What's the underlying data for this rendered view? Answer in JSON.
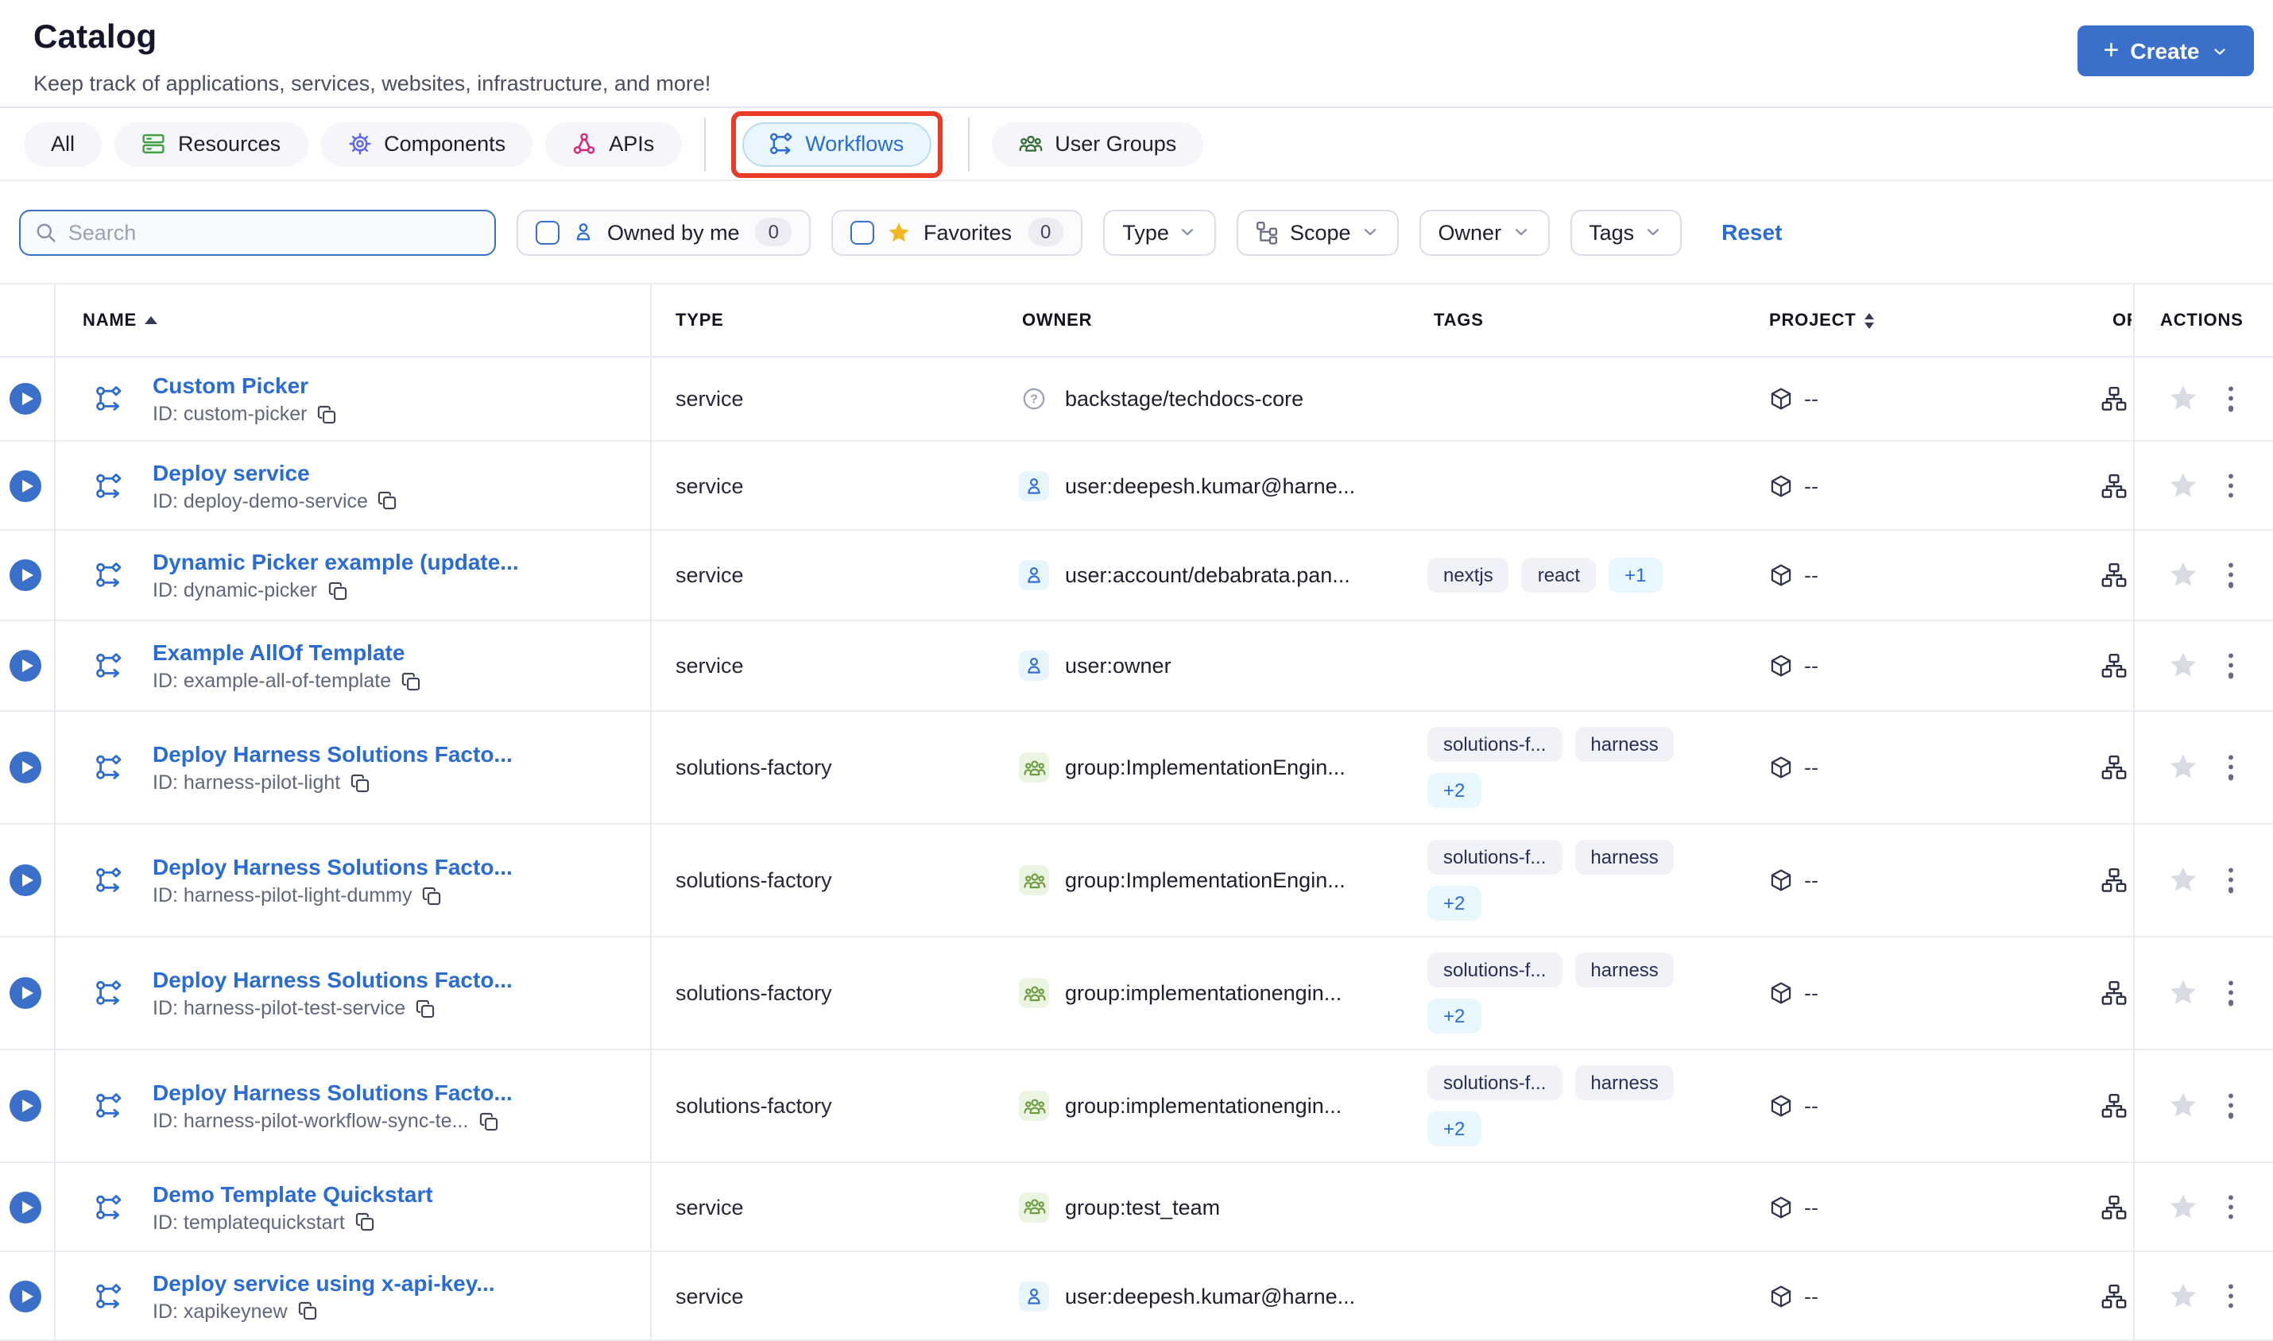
{
  "colors": {
    "primary": "#3A70C9",
    "link": "#2B6CD4",
    "annotation": "#EA3A28",
    "green": "#3FA13F",
    "indigo": "#5D66E3",
    "pink": "#D92475",
    "dgreen": "#2F6B2F",
    "ogreen": "#6A9B3F",
    "tagtext": "#263056",
    "star": "#D8DAE4",
    "favstar": "#F1B822"
  },
  "header": {
    "title": "Catalog",
    "subtitle": "Keep track of applications, services, websites, infrastructure, and more!",
    "create_label": "Create"
  },
  "tabs": {
    "all": "All",
    "resources": "Resources",
    "components": "Components",
    "apis": "APIs",
    "workflows": "Workflows",
    "user_groups": "User Groups"
  },
  "filters": {
    "search_placeholder": "Search",
    "owned_by_me": "Owned by me",
    "owned_count": "0",
    "favorites": "Favorites",
    "favorites_count": "0",
    "type": "Type",
    "scope": "Scope",
    "owner": "Owner",
    "tags": "Tags",
    "reset": "Reset"
  },
  "table": {
    "columns": {
      "name": "NAME",
      "type": "TYPE",
      "owner": "OWNER",
      "tags": "TAGS",
      "project": "PROJECT",
      "org": "OR",
      "actions": "ACTIONS"
    },
    "rows": [
      {
        "name": "Custom Picker",
        "id": "ID: custom-picker",
        "type": "service",
        "owner": "backstage/techdocs-core",
        "project": "--"
      },
      {
        "name": "Deploy service",
        "id": "ID: deploy-demo-service",
        "type": "service",
        "owner": "user:deepesh.kumar@harne...",
        "project": "--"
      },
      {
        "name": "Dynamic Picker example (update...",
        "id": "ID: dynamic-picker",
        "type": "service",
        "owner": "user:account/debabrata.pan...",
        "tags": [
          "nextjs",
          "react"
        ],
        "more": "+1",
        "project": "--"
      },
      {
        "name": "Example AllOf Template",
        "id": "ID: example-all-of-template",
        "type": "service",
        "owner": "user:owner",
        "project": "--"
      },
      {
        "name": "Deploy Harness Solutions Facto...",
        "id": "ID: harness-pilot-light",
        "type": "solutions-factory",
        "owner": "group:ImplementationEngin...",
        "tags": [
          "solutions-f...",
          "harness"
        ],
        "more": "+2",
        "project": "--"
      },
      {
        "name": "Deploy Harness Solutions Facto...",
        "id": "ID: harness-pilot-light-dummy",
        "type": "solutions-factory",
        "owner": "group:ImplementationEngin...",
        "tags": [
          "solutions-f...",
          "harness"
        ],
        "more": "+2",
        "project": "--"
      },
      {
        "name": "Deploy Harness Solutions Facto...",
        "id": "ID: harness-pilot-test-service",
        "type": "solutions-factory",
        "owner": "group:implementationengin...",
        "tags": [
          "solutions-f...",
          "harness"
        ],
        "more": "+2",
        "project": "--"
      },
      {
        "name": "Deploy Harness Solutions Facto...",
        "id": "ID: harness-pilot-workflow-sync-te...",
        "type": "solutions-factory",
        "owner": "group:implementationengin...",
        "tags": [
          "solutions-f...",
          "harness"
        ],
        "more": "+2",
        "project": "--"
      },
      {
        "name": "Demo Template Quickstart",
        "id": "ID: templatequickstart",
        "type": "service",
        "owner": "group:test_team",
        "project": "--"
      },
      {
        "name": "Deploy service using x-api-key...",
        "id": "ID: xapikeynew",
        "type": "service",
        "owner": "user:deepesh.kumar@harne...",
        "project": "--"
      }
    ]
  }
}
